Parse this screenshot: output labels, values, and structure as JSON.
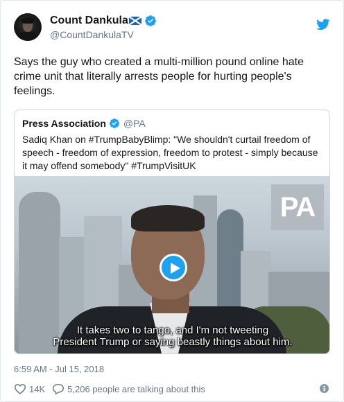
{
  "user": {
    "display_name": "Count Dankula",
    "handle": "@CountDankulaTV"
  },
  "tweet": {
    "text": "Says the guy who created a multi-million pound online hate crime unit that literally arrests people for hurting people's feelings.",
    "timestamp": "6:59 AM - Jul 15, 2018",
    "likes": "14K",
    "talking": "5,206 people are talking about this"
  },
  "quoted": {
    "display_name": "Press Association",
    "handle": "@PA",
    "text": "Sadiq Khan on #TrumpBabyBlimp: \"We shouldn't curtail freedom of speech - freedom of expression, freedom to protest - simply because it may offend somebody\" #TrumpVisitUK",
    "video": {
      "logo_text": "PA",
      "caption_line1": "It takes two to tango, and I'm not tweeting",
      "caption_line2": "President Trump or saying beastly things about him."
    }
  },
  "icons": {
    "verified": "verified-badge-icon",
    "brand": "twitter-bird-icon",
    "flag": "scotland-flag-icon",
    "like": "heart-icon",
    "reply": "speech-bubble-icon",
    "info": "info-icon",
    "play": "play-icon"
  },
  "colors": {
    "accent": "#1da1f2",
    "text": "#14171a",
    "muted": "#657786",
    "border": "#e1e8ed"
  }
}
